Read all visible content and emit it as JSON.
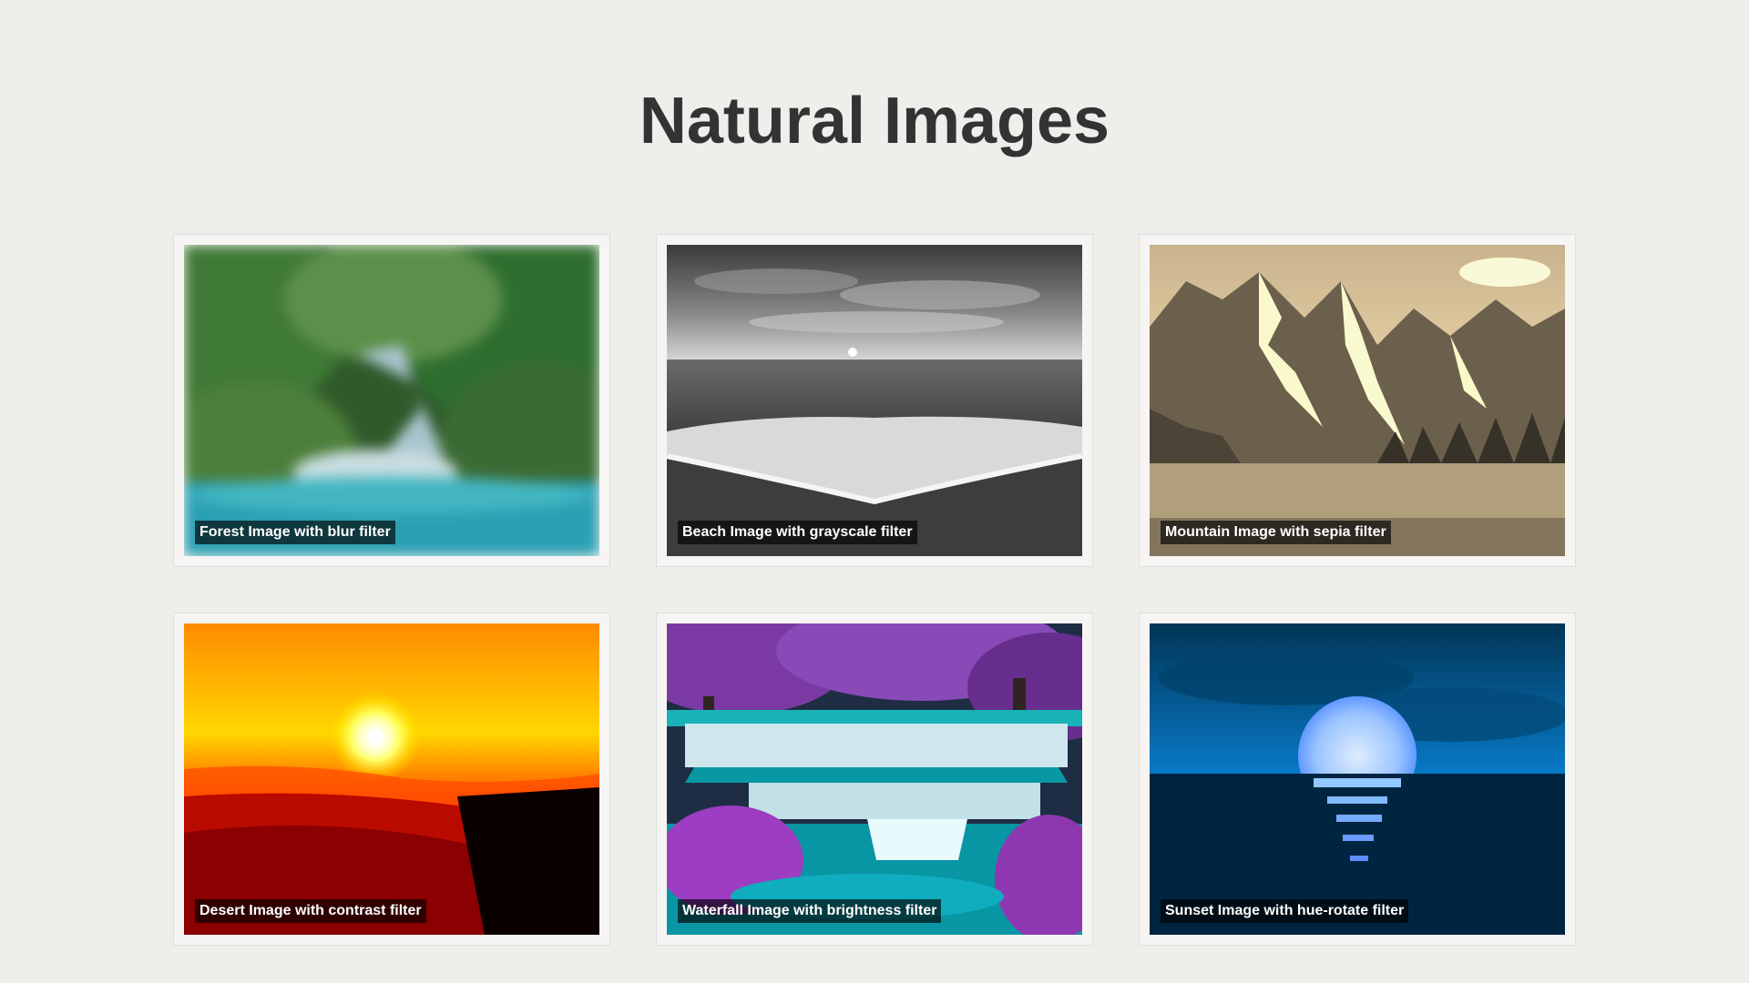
{
  "page": {
    "title": "Natural Images"
  },
  "gallery": {
    "items": [
      {
        "name": "forest",
        "caption": "Forest Image with blur filter",
        "filter": "blur"
      },
      {
        "name": "beach",
        "caption": "Beach Image with grayscale filter",
        "filter": "grayscale"
      },
      {
        "name": "mountain",
        "caption": "Mountain Image with sepia filter",
        "filter": "sepia"
      },
      {
        "name": "desert",
        "caption": "Desert Image with contrast filter",
        "filter": "contrast"
      },
      {
        "name": "waterfall",
        "caption": "Waterfall Image with brightness filter",
        "filter": "brightness"
      },
      {
        "name": "sunset",
        "caption": "Sunset Image with hue-rotate filter",
        "filter": "hue-rotate"
      }
    ]
  },
  "colors": {
    "background": "#efeeeb",
    "title": "#333333",
    "caption_bg": "rgba(0,0,0,0.65)"
  }
}
